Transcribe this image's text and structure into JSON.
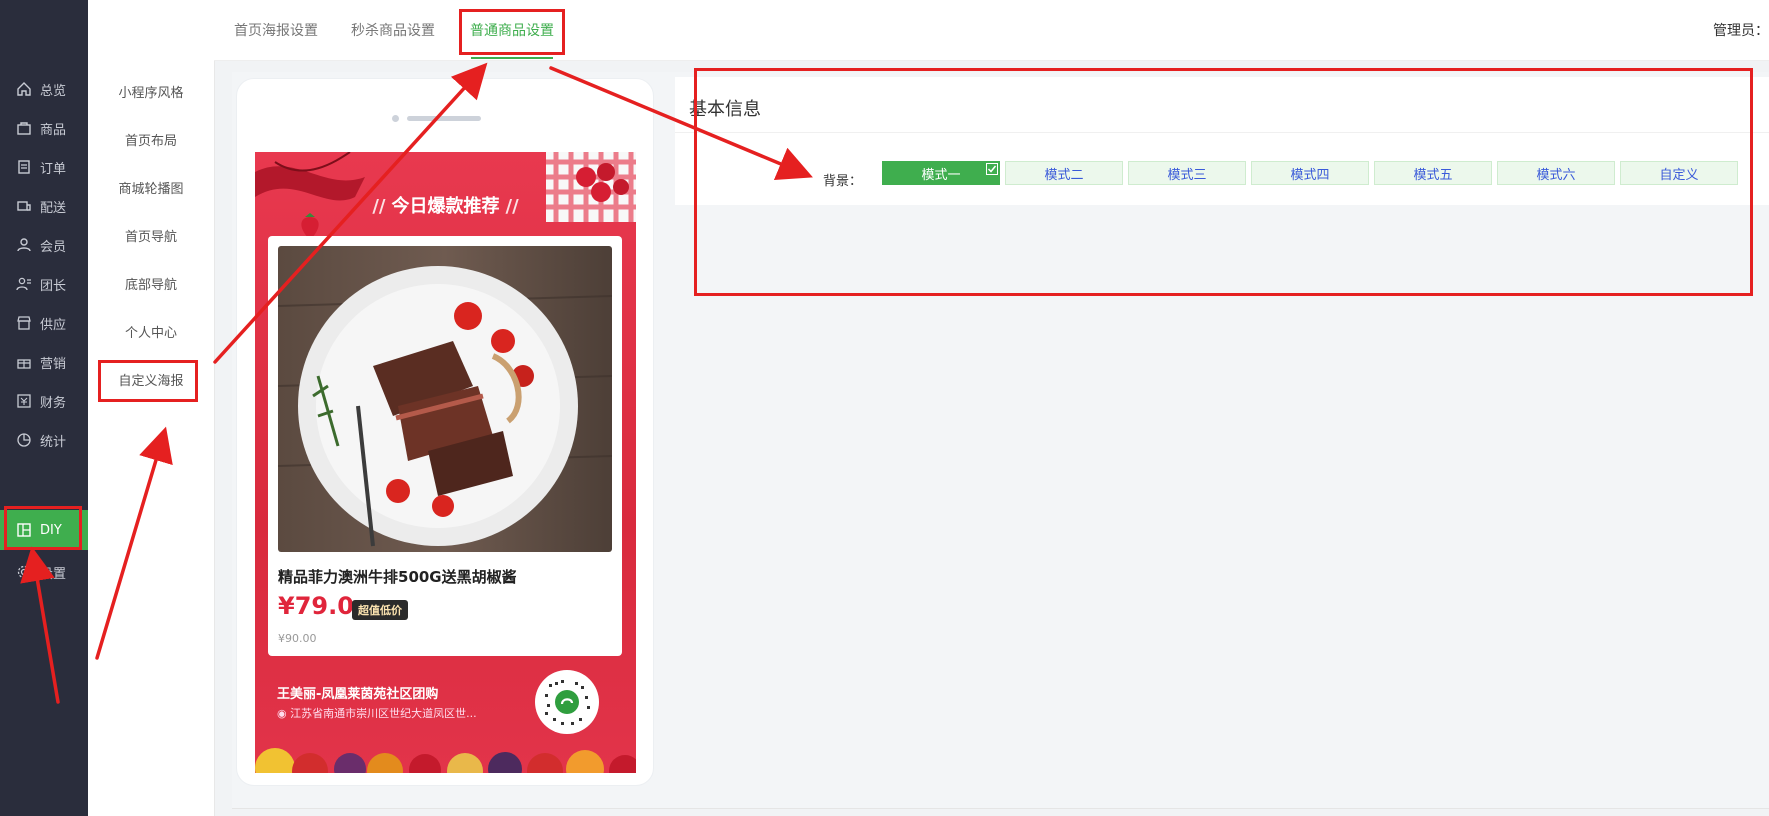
{
  "sidebar": {
    "items": [
      {
        "label": "总览",
        "icon": "home-icon"
      },
      {
        "label": "商品",
        "icon": "bag-icon"
      },
      {
        "label": "订单",
        "icon": "order-icon"
      },
      {
        "label": "配送",
        "icon": "delivery-icon"
      },
      {
        "label": "会员",
        "icon": "user-icon"
      },
      {
        "label": "团长",
        "icon": "leader-icon"
      },
      {
        "label": "供应",
        "icon": "shop-icon"
      },
      {
        "label": "营销",
        "icon": "gift-icon"
      },
      {
        "label": "财务",
        "icon": "finance-icon"
      },
      {
        "label": "统计",
        "icon": "chart-icon"
      },
      {
        "label": "DIY",
        "icon": "layout-icon",
        "active": true
      },
      {
        "label": "设置",
        "icon": "gear-icon"
      }
    ]
  },
  "submenu": {
    "items": [
      {
        "label": "小程序风格"
      },
      {
        "label": "首页布局"
      },
      {
        "label": "商城轮播图"
      },
      {
        "label": "首页导航"
      },
      {
        "label": "底部导航"
      },
      {
        "label": "个人中心"
      },
      {
        "label": "自定义海报",
        "active": true
      }
    ]
  },
  "tabs": {
    "items": [
      {
        "label": "首页海报设置"
      },
      {
        "label": "秒杀商品设置"
      },
      {
        "label": "普通商品设置",
        "active": true
      }
    ],
    "admin_label": "管理员："
  },
  "poster": {
    "headline": "今日爆款推荐",
    "product_name": "精品菲力澳洲牛排500G送黑胡椒酱",
    "price": "¥79.0",
    "price_tag": "超值低价",
    "original_price": "¥90.00",
    "store_name": "王美丽-凤凰莱茵苑社区团购",
    "store_address": "江苏省南通市崇川区世纪大道凤区世..."
  },
  "panel": {
    "title": "基本信息",
    "background_label": "背景：",
    "modes": [
      {
        "label": "模式一",
        "selected": true
      },
      {
        "label": "模式二"
      },
      {
        "label": "模式三"
      },
      {
        "label": "模式四"
      },
      {
        "label": "模式五"
      },
      {
        "label": "模式六"
      },
      {
        "label": "自定义"
      }
    ]
  },
  "colors": {
    "sidebar_bg": "#2a2d3c",
    "accent_green": "#3fae4e",
    "poster_red": "#e0253b",
    "annotation_red": "#e52020"
  }
}
